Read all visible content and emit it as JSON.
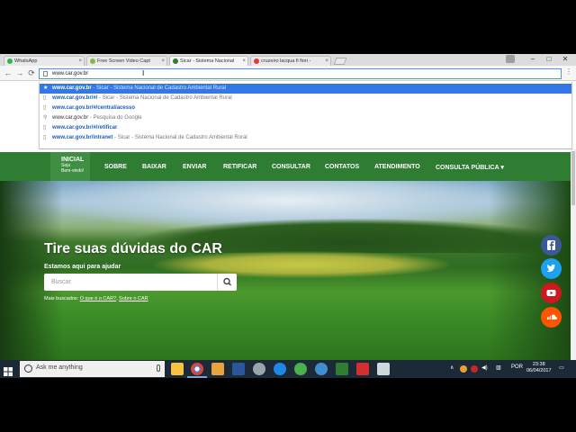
{
  "browser": {
    "tabs": [
      {
        "title": "WhatsApp",
        "favicon_color": "#2fb84f",
        "active": false
      },
      {
        "title": "Free Screen Video Capt",
        "favicon_color": "#8ab34a",
        "active": false
      },
      {
        "title": "Sicar - Sistema Nacional",
        "favicon_color": "#2e7d32",
        "active": true
      },
      {
        "title": "cruzeiro lacqua fi fiori -",
        "favicon_color": "#e53935",
        "active": false
      }
    ],
    "tab_close": "×",
    "window_controls": {
      "minimize": "–",
      "maximize": "□",
      "close": "✕"
    },
    "nav": {
      "back": "←",
      "forward": "→",
      "reload": "⟳"
    },
    "address": {
      "value": "www.car.gov.br"
    },
    "suggestions": [
      {
        "icon": "star-icon",
        "glyph": "★",
        "url": "www.car.gov.br",
        "desc": " - Sicar - Sistema Nacional de Cadastro Ambiental Rural",
        "selected": true
      },
      {
        "icon": "page-icon",
        "glyph": "▯",
        "url": "www.car.gov.br/#/",
        "desc": " - Sicar - Sistema Nacional de Cadastro Ambiental Rural",
        "selected": false
      },
      {
        "icon": "page-icon",
        "glyph": "▯",
        "url": "www.car.gov.br/#/central/acesso",
        "desc": "",
        "selected": false
      },
      {
        "icon": "search-icon",
        "glyph": "⚲",
        "url_plain": "www.car.gov.br",
        "desc": " - Pesquisa do Google",
        "selected": false
      },
      {
        "icon": "page-icon",
        "glyph": "▯",
        "url": "www.car.gov.br/#/retificar",
        "desc": "",
        "selected": false
      },
      {
        "icon": "page-icon",
        "glyph": "▯",
        "url": "www.car.gov.br/intranet",
        "desc": " - Sicar - Sistema Nacional de Cadastro Ambiental Rural",
        "selected": false
      }
    ]
  },
  "site": {
    "nav": {
      "home_title": "INICIAL",
      "home_sub_1": "Seja",
      "home_sub_2": "Bem-vindo!",
      "items": [
        "SOBRE",
        "BAIXAR",
        "ENVIAR",
        "RETIFICAR",
        "CONSULTAR",
        "CONTATOS",
        "ATENDIMENTO",
        "CONSULTA PÚBLICA ▾"
      ]
    },
    "hero": {
      "title": "Tire suas dúvidas do CAR",
      "subtitle": "Estamos aqui para ajudar",
      "search_placeholder": "Buscar",
      "popular_label": "Mais buscados: ",
      "popular_links": [
        "O que é o CAR?",
        "Sobre o CAR"
      ],
      "popular_sep": ", "
    },
    "social": [
      {
        "name": "facebook-icon",
        "glyph": "f",
        "color": "#3b5998"
      },
      {
        "name": "twitter-icon",
        "glyph": "t",
        "color": "#1da1f2"
      },
      {
        "name": "youtube-icon",
        "glyph": "▶",
        "color": "#cc181e"
      },
      {
        "name": "soundcloud-icon",
        "glyph": "☁",
        "color": "#ff5500"
      }
    ]
  },
  "taskbar": {
    "search_placeholder": "Ask me anything",
    "apps": [
      {
        "name": "file-explorer-icon",
        "color": "#f5c242"
      },
      {
        "name": "chrome-icon",
        "color": "#db4437"
      },
      {
        "name": "settings-app-icon",
        "color": "#e8a33d"
      },
      {
        "name": "word-icon",
        "color": "#2b579a"
      },
      {
        "name": "disc-app-icon",
        "color": "#9aa4ad"
      },
      {
        "name": "globe-app-icon",
        "color": "#1e88e5"
      },
      {
        "name": "green-app-icon",
        "color": "#4caf50"
      },
      {
        "name": "magnifier-app-icon",
        "color": "#3d8fd1"
      },
      {
        "name": "leaf-app-icon",
        "color": "#2e7d32"
      },
      {
        "name": "pdf-app-icon",
        "color": "#d32f2f"
      },
      {
        "name": "window-app-icon",
        "color": "#cfd8dc"
      }
    ],
    "tray": {
      "lang": "POR",
      "time": "23:38",
      "date": "06/04/2017"
    }
  },
  "colors": {
    "brand_green": "#2e7d32",
    "selection_blue": "#3477e6"
  }
}
